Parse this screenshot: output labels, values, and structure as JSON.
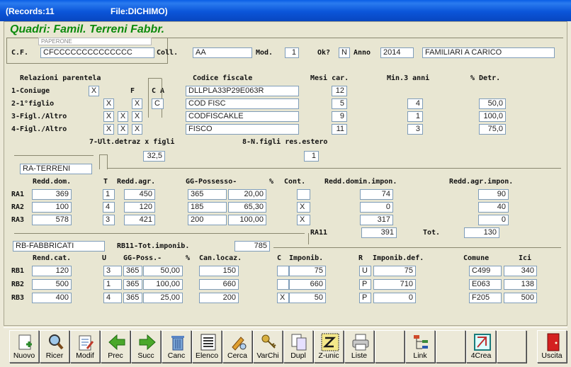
{
  "window": {
    "records": "(Records:11",
    "file": "File:DICHIMO)"
  },
  "heading": "Quadri: Famil. Terreni Fabbr.",
  "top": {
    "name_value": "PAPERONE",
    "cf_label": "C.F.",
    "cf_value": "CFCCCCCCCCCCCCCC",
    "coll_label": "Coll.",
    "coll_value": "AA",
    "mod_label": "Mod.",
    "mod_value": "1",
    "ok_label": "Ok?",
    "ok_value": "N",
    "anno_label": "Anno",
    "anno_value": "2014",
    "desc_value": "FAMILIARI A CARICO"
  },
  "family": {
    "headers": {
      "rel": "Relazioni parentela",
      "f": "F",
      "ca": "C A",
      "cf": "Codice fiscale",
      "mesi": "Mesi car.",
      "min3": "Min.3 anni",
      "detr": "% Detr."
    },
    "rows": [
      {
        "label": "1-Coniuge",
        "c1": "X",
        "c2": "",
        "c3": "",
        "ca": "",
        "cf": "DLLPLA33P29E063R",
        "mesi": "12",
        "min3": "",
        "detr": ""
      },
      {
        "label": "2-1°figlio",
        "c1": "X",
        "c2": "",
        "c3": "X",
        "ca": "C",
        "cf": "COD FISC",
        "mesi": "5",
        "min3": "4",
        "detr": "50,0"
      },
      {
        "label": "3-Figl./Altro",
        "c1": "X",
        "c2": "X",
        "c3": "X",
        "ca": "",
        "cf": "CODFISCAKLE",
        "mesi": "9",
        "min3": "1",
        "detr": "100,0"
      },
      {
        "label": "4-Figl./Altro",
        "c1": "X",
        "c2": "X",
        "c3": "X",
        "ca": "",
        "cf": "FISCO",
        "mesi": "11",
        "min3": "3",
        "detr": "75,0"
      }
    ],
    "ult_label": "7-Ult.detraz x figli",
    "ult_value": "32,5",
    "nfigli_label": "8-N.figli res.estero",
    "nfigli_value": "1"
  },
  "terreni": {
    "section": "RA-TERRENI",
    "headers": {
      "rd": "Redd.dom.",
      "t": "T",
      "ra": "Redd.agr.",
      "gg": "GG-Possesso-",
      "pct": "%",
      "cont": "Cont.",
      "rdi": "Redd.domin.impon.",
      "rai": "Redd.agr.impon."
    },
    "rows": [
      {
        "label": "RA1",
        "rd": "369",
        "t": "1",
        "ra": "450",
        "gg": "365",
        "pct": "20,00",
        "cont": "",
        "rdi": "74",
        "rai": "90"
      },
      {
        "label": "RA2",
        "rd": "100",
        "t": "4",
        "ra": "120",
        "gg": "185",
        "pct": "65,30",
        "cont": "X",
        "rdi": "0",
        "rai": "40"
      },
      {
        "label": "RA3",
        "rd": "578",
        "t": "3",
        "ra": "421",
        "gg": "200",
        "pct": "100,00",
        "cont": "X",
        "rdi": "317",
        "rai": "0"
      }
    ],
    "ra11_label": "RA11",
    "ra11_value": "391",
    "tot_label": "Tot.",
    "tot_value": "130"
  },
  "fabbricati": {
    "section": "RB-FABBRICATI",
    "rb11_label": "RB11-Tot.imponib.",
    "rb11_value": "785",
    "headers": {
      "rc": "Rend.cat.",
      "u": "U",
      "gg": "GG-Poss.-",
      "pct": "%",
      "can": "Can.locaz.",
      "c": "C",
      "imp": "Imponib.",
      "r": "R",
      "impdef": "Imponib.def.",
      "comune": "Comune",
      "ici": "Ici"
    },
    "rows": [
      {
        "label": "RB1",
        "rc": "120",
        "u": "3",
        "gg": "365",
        "pct": "50,00",
        "can": "150",
        "c": "",
        "imp": "75",
        "r": "U",
        "impdef": "75",
        "comune": "C499",
        "ici": "340"
      },
      {
        "label": "RB2",
        "rc": "500",
        "u": "1",
        "gg": "365",
        "pct": "100,00",
        "can": "660",
        "c": "",
        "imp": "660",
        "r": "P",
        "impdef": "710",
        "comune": "E063",
        "ici": "138"
      },
      {
        "label": "RB3",
        "rc": "400",
        "u": "4",
        "gg": "365",
        "pct": "25,00",
        "can": "200",
        "c": "X",
        "imp": "50",
        "r": "P",
        "impdef": "0",
        "comune": "F205",
        "ici": "500"
      }
    ]
  },
  "toolbar": [
    {
      "label": "Nuovo",
      "icon": "new-doc-icon"
    },
    {
      "label": "Ricer",
      "icon": "magnifier-icon"
    },
    {
      "label": "Modif",
      "icon": "edit-doc-icon"
    },
    {
      "label": "Prec",
      "icon": "arrow-left-icon"
    },
    {
      "label": "Succ",
      "icon": "arrow-right-icon"
    },
    {
      "label": "Canc",
      "icon": "trash-icon"
    },
    {
      "label": "Elenco",
      "icon": "list-icon"
    },
    {
      "label": "Cerca",
      "icon": "search-pen-icon"
    },
    {
      "label": "VarChi",
      "icon": "keys-icon"
    },
    {
      "label": "Dupl",
      "icon": "duplicate-icon"
    },
    {
      "label": "Z-unic",
      "icon": "z-unic-icon"
    },
    {
      "label": "Liste",
      "icon": "printer-icon"
    },
    {
      "label": "",
      "icon": "blank"
    },
    {
      "label": "Link",
      "icon": "link-tree-icon"
    },
    {
      "label": "",
      "icon": "blank"
    },
    {
      "label": "4Crea",
      "icon": "create-icon"
    },
    {
      "label": "",
      "icon": "blank"
    },
    {
      "label": "Uscita",
      "icon": "exit-door-icon"
    }
  ]
}
